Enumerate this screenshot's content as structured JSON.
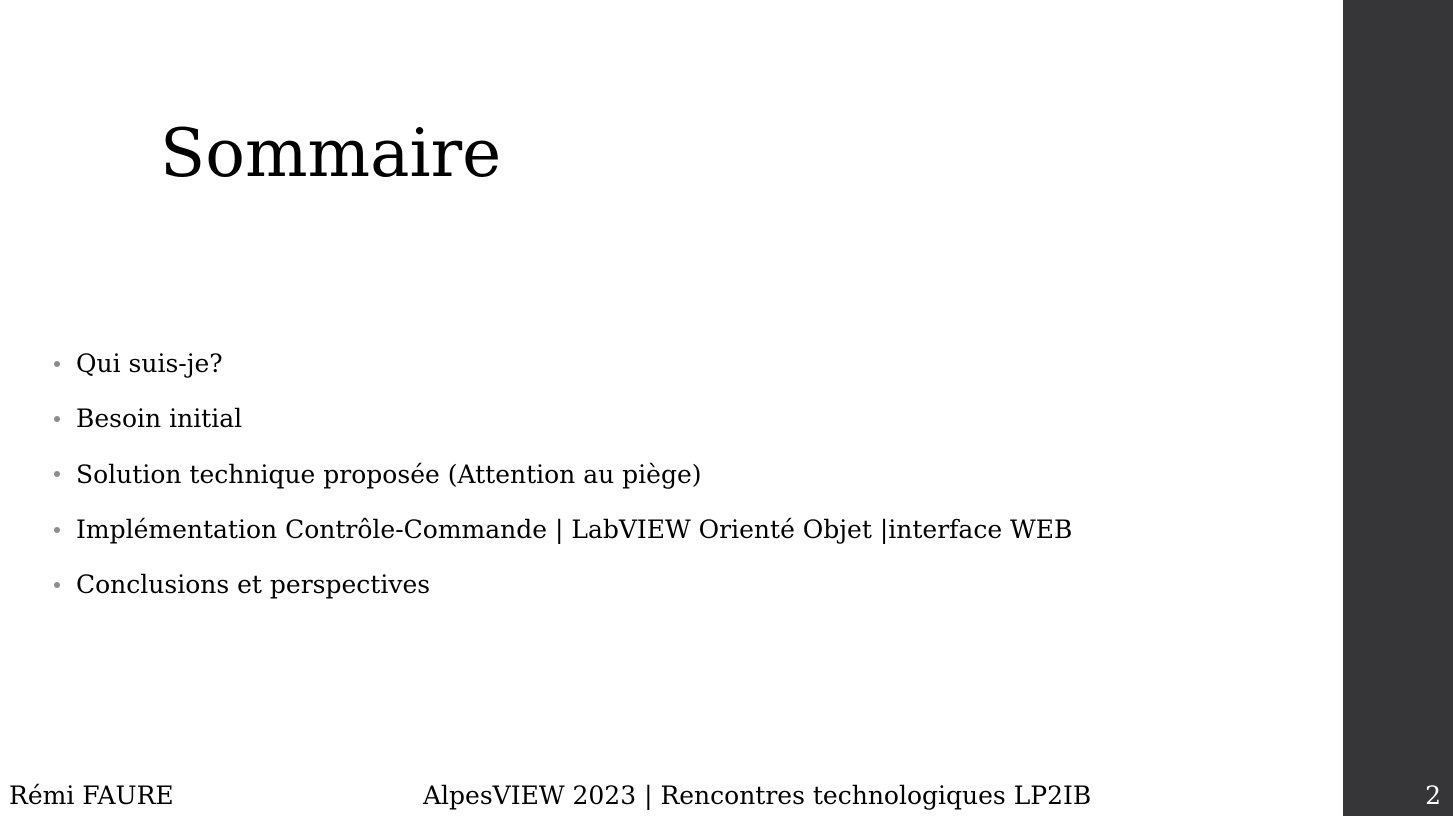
{
  "slide": {
    "title": "Sommaire",
    "bullets": [
      "Qui suis-je?",
      "Besoin initial",
      "Solution technique proposée (Attention au piège)",
      "Implémentation Contrôle-Commande | LabVIEW Orienté Objet |interface WEB",
      "Conclusions et perspectives"
    ],
    "footer": {
      "author": "Rémi FAURE",
      "event": "AlpesVIEW 2023 | Rencontres technologiques LP2IB"
    },
    "page_number": "2"
  },
  "colors": {
    "background": "#ffffff",
    "sidebar": "#363638",
    "text": "#000000",
    "page_number": "#ffffff",
    "bullet_dot": "#8c8c8c"
  }
}
